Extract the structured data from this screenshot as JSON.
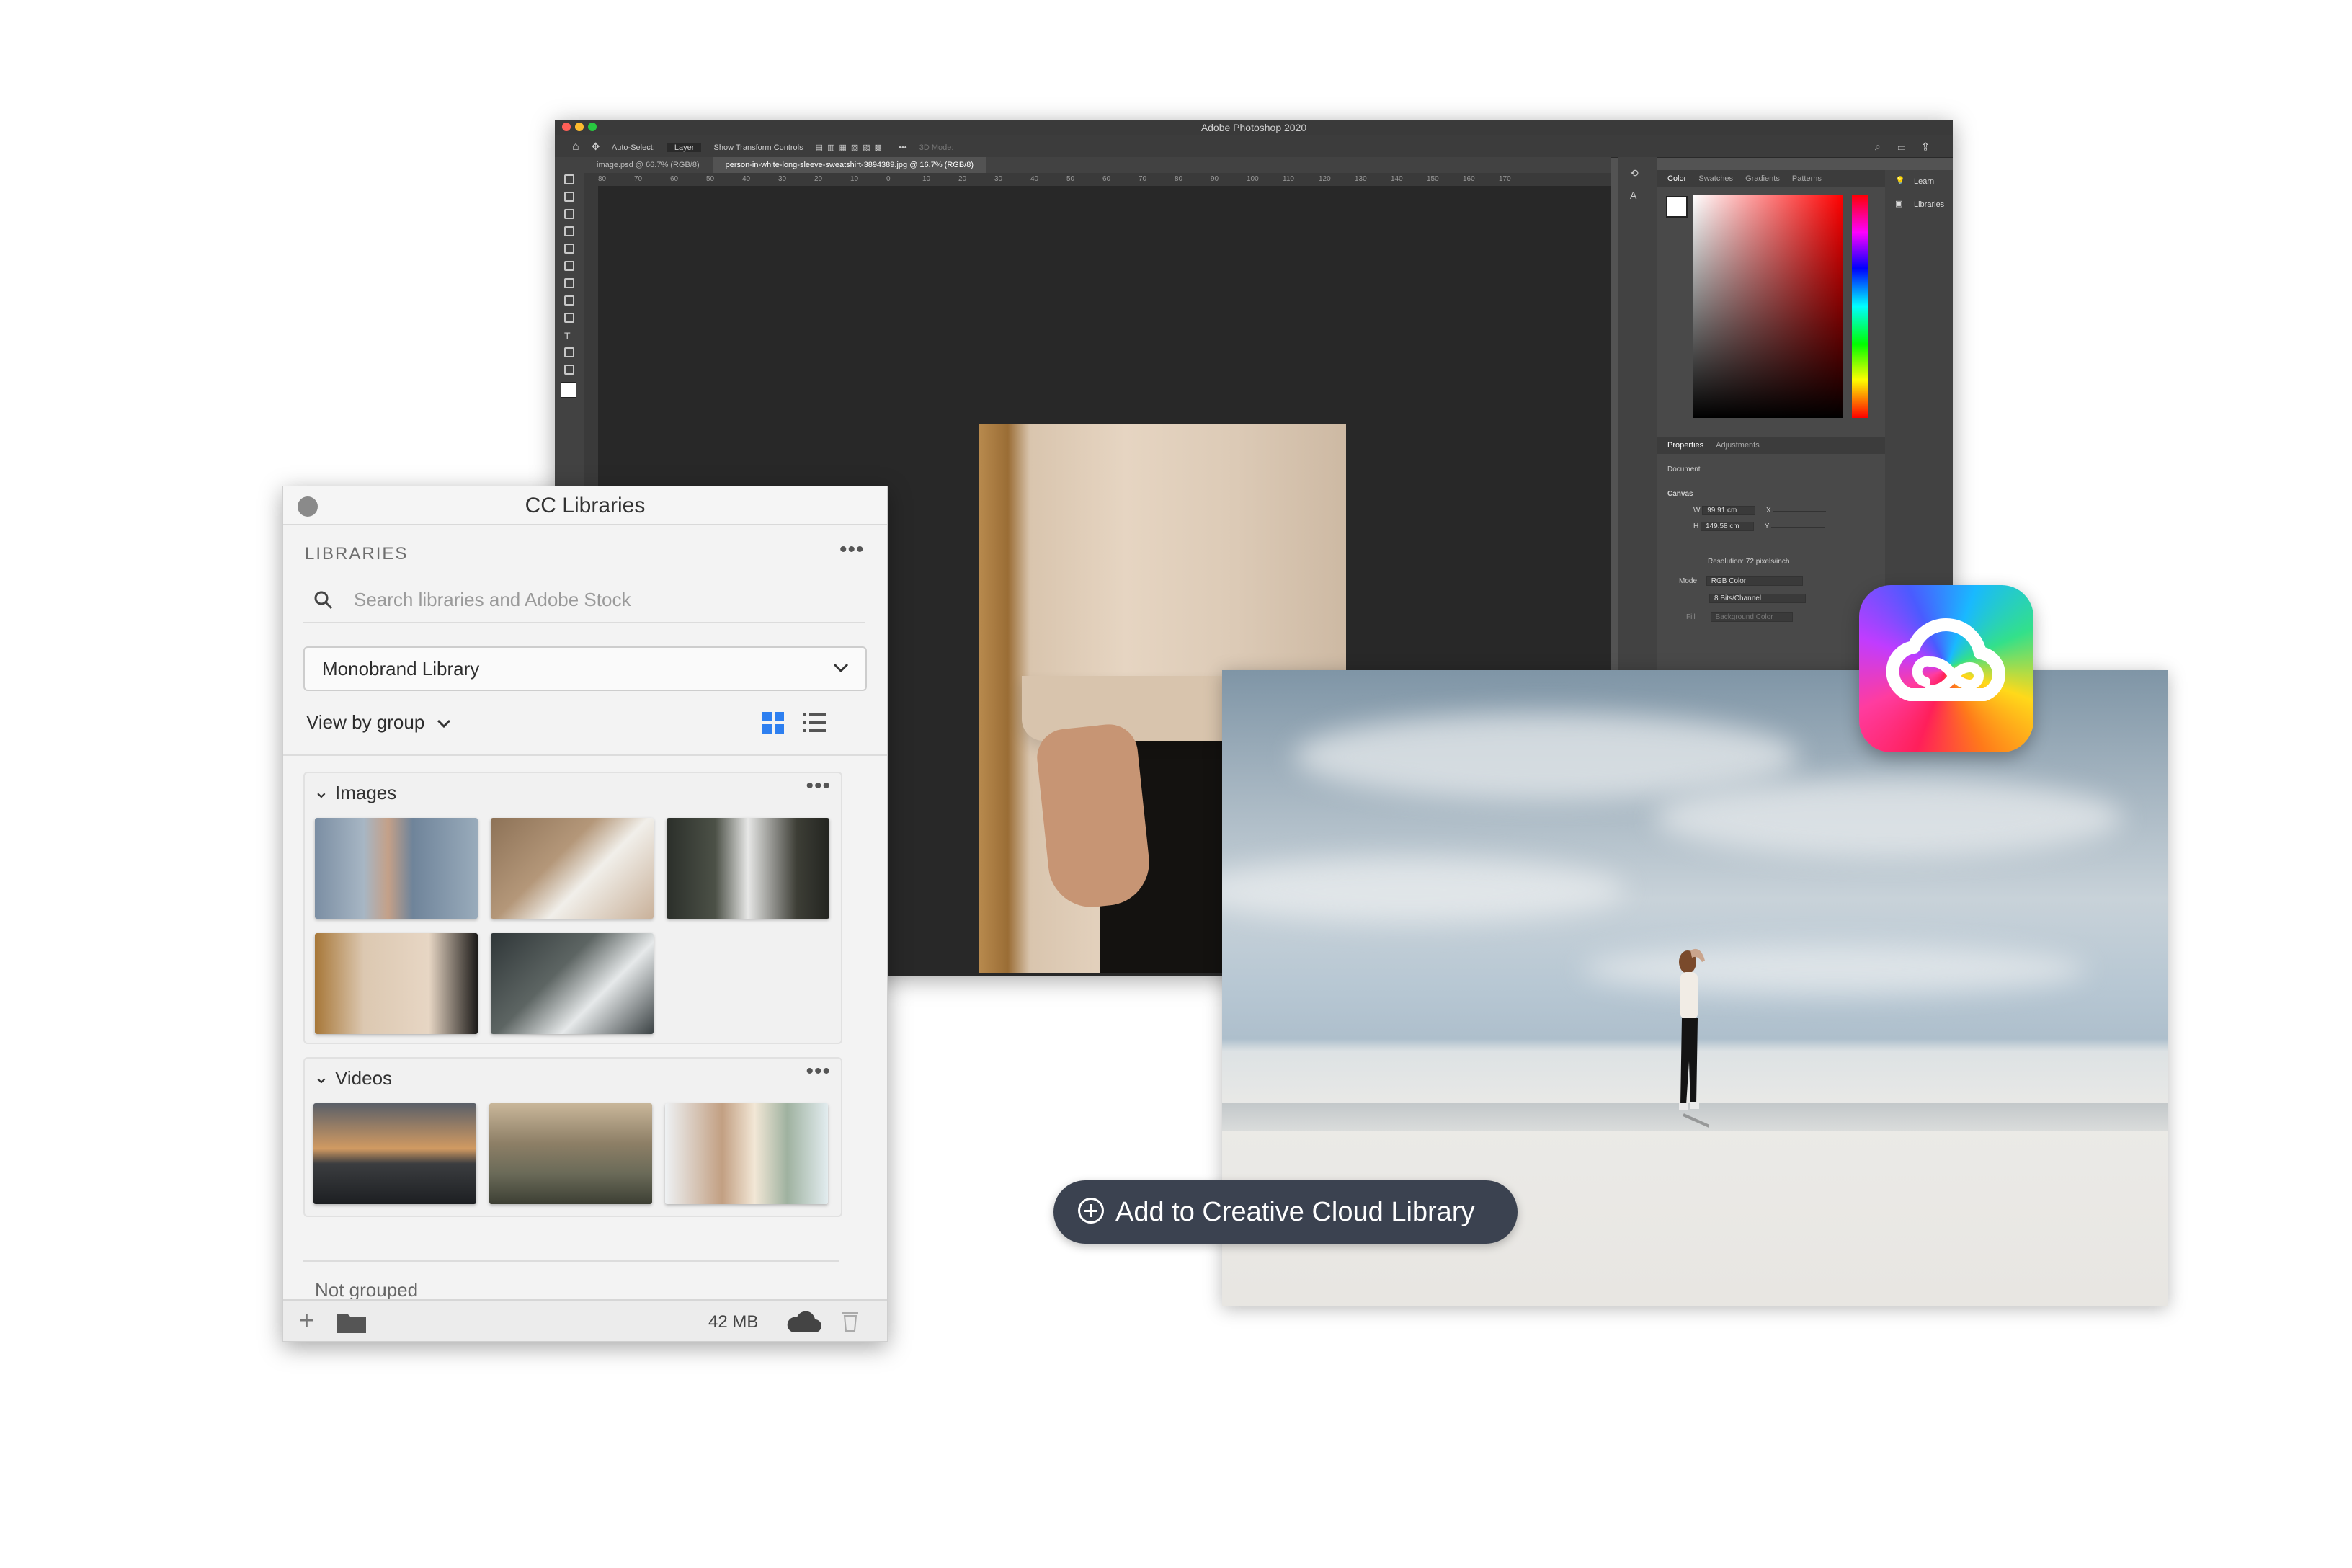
{
  "photoshop": {
    "title": "Adobe Photoshop 2020",
    "options_bar": [
      "Auto-Select:",
      "Layer",
      "Show Transform Controls",
      "3D Mode:"
    ],
    "tabs": [
      "image.psd @ 66.7% (RGB/8)",
      "person-in-white-long-sleeve-sweatshirt-3894389.jpg @ 16.7% (RGB/8)"
    ],
    "ruler_ticks": [
      "80",
      "70",
      "60",
      "50",
      "40",
      "30",
      "20",
      "10",
      "0",
      "10",
      "20",
      "30",
      "40",
      "50",
      "60",
      "70",
      "80",
      "90",
      "100",
      "110",
      "120",
      "130",
      "140",
      "150",
      "160",
      "170"
    ],
    "color_panel_tabs": [
      "Color",
      "Swatches",
      "Gradients",
      "Patterns"
    ],
    "props_tabs": [
      "Properties",
      "Adjustments"
    ],
    "props": {
      "document": "Document",
      "canvas": "Canvas",
      "w_label": "W",
      "w_value": "99.91 cm",
      "h_label": "H",
      "h_value": "149.58 cm",
      "x_label": "X",
      "y_label": "Y",
      "resolution": "Resolution: 72 pixels/inch",
      "mode_label": "Mode",
      "mode_value": "RGB Color",
      "bits_value": "8 Bits/Channel",
      "fill_label": "Fill",
      "fill_value": "Background Color"
    },
    "right_panel": [
      "Learn",
      "Libraries"
    ]
  },
  "library": {
    "title": "CC Libraries",
    "header": "LIBRARIES",
    "search_placeholder": "Search libraries and Adobe Stock",
    "selected_library": "Monobrand Library",
    "view_by": "View by group",
    "groups": [
      {
        "title": "Images"
      },
      {
        "title": "Videos"
      }
    ],
    "not_grouped": "Not grouped",
    "storage": "42 MB"
  },
  "overlay": {
    "add_button_label": "Add to Creative Cloud Library"
  },
  "colors": {
    "ps_bg": "#535353",
    "ps_canvas": "#282828",
    "library_bg": "#f3f3f3",
    "accent_blue": "#2d7ff0",
    "button_bg": "#3b4250"
  }
}
